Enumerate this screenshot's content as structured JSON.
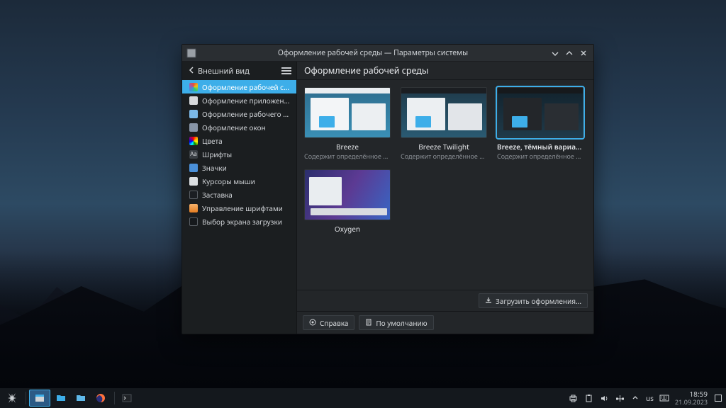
{
  "window": {
    "title": "Оформление рабочей среды — Параметры системы"
  },
  "sidebar": {
    "back_label": "Внешний вид",
    "items": [
      {
        "label": "Оформление рабочей среды"
      },
      {
        "label": "Оформление приложений"
      },
      {
        "label": "Оформление рабочего с..."
      },
      {
        "label": "Оформление окон"
      },
      {
        "label": "Цвета"
      },
      {
        "label": "Шрифты"
      },
      {
        "label": "Значки"
      },
      {
        "label": "Курсоры мыши"
      },
      {
        "label": "Заставка"
      },
      {
        "label": "Управление шрифтами"
      },
      {
        "label": "Выбор экрана загрузки"
      }
    ]
  },
  "main": {
    "title": "Оформление рабочей среды",
    "download_label": "Загрузить оформления...",
    "themes": [
      {
        "name": "Breeze",
        "desc": "Содержит определённое распо..."
      },
      {
        "name": "Breeze Twilight",
        "desc": "Содержит определённое распо..."
      },
      {
        "name": "Breeze, тёмный вариант",
        "desc": "Содержит определённое рас..."
      },
      {
        "name": "Oxygen",
        "desc": ""
      }
    ]
  },
  "footer": {
    "help": "Справка",
    "defaults": "По умолчанию"
  },
  "taskbar": {
    "layout": "us",
    "time": "18:59",
    "date": "21.09.2023"
  }
}
